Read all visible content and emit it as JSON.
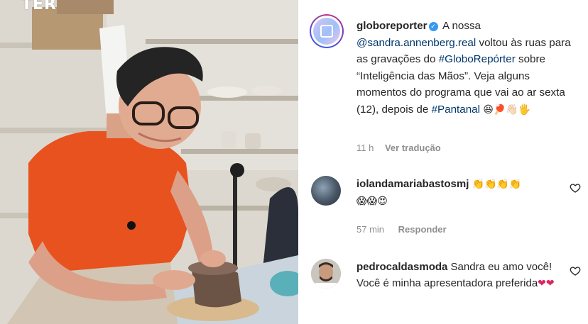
{
  "media": {
    "watermark": "TER"
  },
  "post": {
    "username": "globoreporter",
    "caption_parts": {
      "a": "A nossa",
      "mention": "@sandra.annenberg.real",
      "b": "voltou às ruas para as gravações do",
      "hashtag1": "#GloboRepórter",
      "c": "sobre “Inteligência das Mãos”. Veja alguns momentos do programa que vai ao ar sexta (12), depois de",
      "hashtag2": "#Pantanal",
      "emojis": "😆🏓👋🏻🖐"
    },
    "time": "11 h",
    "translate": "Ver tradução"
  },
  "comments": [
    {
      "username": "iolandamariabastosmj",
      "line1": "👏👏👏👏",
      "line2": "😱😱😍",
      "time": "57 min",
      "reply": "Responder"
    },
    {
      "username": "pedrocaldasmoda",
      "text": "Sandra eu amo você! Você é minha apresentadora preferida",
      "emojis": "❤❤"
    }
  ],
  "icons": {
    "verified": "verified-badge-icon",
    "like": "heart-outline-icon"
  },
  "colors": {
    "link": "#00376b",
    "muted": "#8e8e8e",
    "verified": "#3897f0"
  }
}
